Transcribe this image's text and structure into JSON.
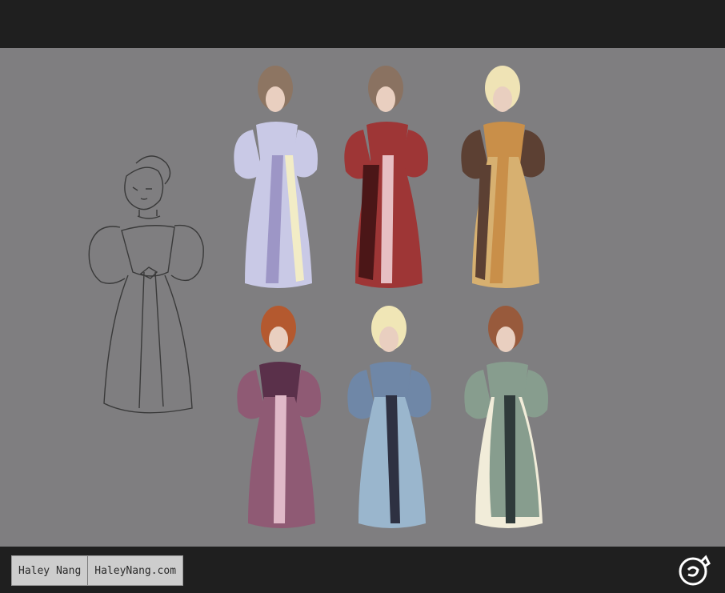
{
  "credit": {
    "name": "Haley Nang",
    "url": "HaleyNang.com"
  },
  "logo": {
    "icon": "fox-head-icon",
    "color": "#ffffff"
  },
  "figures": [
    {
      "kind": "sketch",
      "icon": "lady-sketch-icon"
    },
    {
      "kind": "color",
      "hair": "#8d7562",
      "dress": "#c9c9e6",
      "sash": "#9d96c6",
      "accent": "#f2ecc6"
    },
    {
      "kind": "color",
      "hair": "#8a7261",
      "dress": "#9e3636",
      "sash": "#e7bfc3",
      "accent": "#4b1617"
    },
    {
      "kind": "color",
      "hair": "#efe3b5",
      "dress": "#c98f49",
      "sash": "#d7b070",
      "accent": "#5c4033"
    },
    {
      "kind": "color",
      "hair": "#b4592f",
      "dress": "#8f5a74",
      "sash": "#e0b9c8",
      "accent": "#5a304a"
    },
    {
      "kind": "color",
      "hair": "#f0e6b6",
      "dress": "#6f87a7",
      "sash": "#2e3142",
      "accent": "#9ab6cd"
    },
    {
      "kind": "color",
      "hair": "#985a3c",
      "dress": "#879d8e",
      "sash": "#2f3a3a",
      "accent": "#f1ecd9"
    }
  ]
}
